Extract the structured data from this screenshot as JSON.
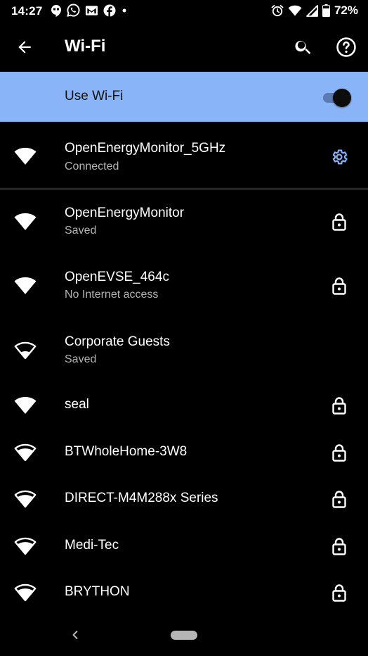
{
  "status_bar": {
    "time": "14:27",
    "notification_icons": [
      "hangouts-icon",
      "whatsapp-icon",
      "gmail-icon",
      "facebook-icon",
      "dot-icon"
    ],
    "system_icons": [
      "alarm-icon",
      "wifi-icon",
      "signal-icon",
      "battery-icon"
    ],
    "battery": "72%"
  },
  "app_bar": {
    "title": "Wi-Fi",
    "back_icon": "arrow-left-icon",
    "search_icon": "search-icon",
    "help_icon": "help-icon"
  },
  "use_wifi": {
    "label": "Use Wi-Fi",
    "enabled": true
  },
  "connected": {
    "name": "OpenEnergyMonitor_5GHz",
    "status": "Connected",
    "trailing_icon": "gear-icon",
    "accent_color": "#8ab4f8"
  },
  "networks": [
    {
      "name": "OpenEnergyMonitor",
      "status": "Saved",
      "secured": true,
      "signal": 4
    },
    {
      "name": "OpenEVSE_464c",
      "status": "No Internet access",
      "secured": true,
      "signal": 4
    },
    {
      "name": "Corporate Guests",
      "status": "Saved",
      "secured": false,
      "signal": 2
    },
    {
      "name": "seal",
      "status": "",
      "secured": true,
      "signal": 4
    },
    {
      "name": "BTWholeHome-3W8",
      "status": "",
      "secured": true,
      "signal": 3
    },
    {
      "name": "DIRECT-M4M288x Series",
      "status": "",
      "secured": true,
      "signal": 3
    },
    {
      "name": "Medi-Tec",
      "status": "",
      "secured": true,
      "signal": 3
    },
    {
      "name": "BRYTHON",
      "status": "",
      "secured": true,
      "signal": 3
    }
  ],
  "nav_bar": {
    "back_icon": "chevron-left-icon",
    "home_icon": "home-pill-icon"
  }
}
